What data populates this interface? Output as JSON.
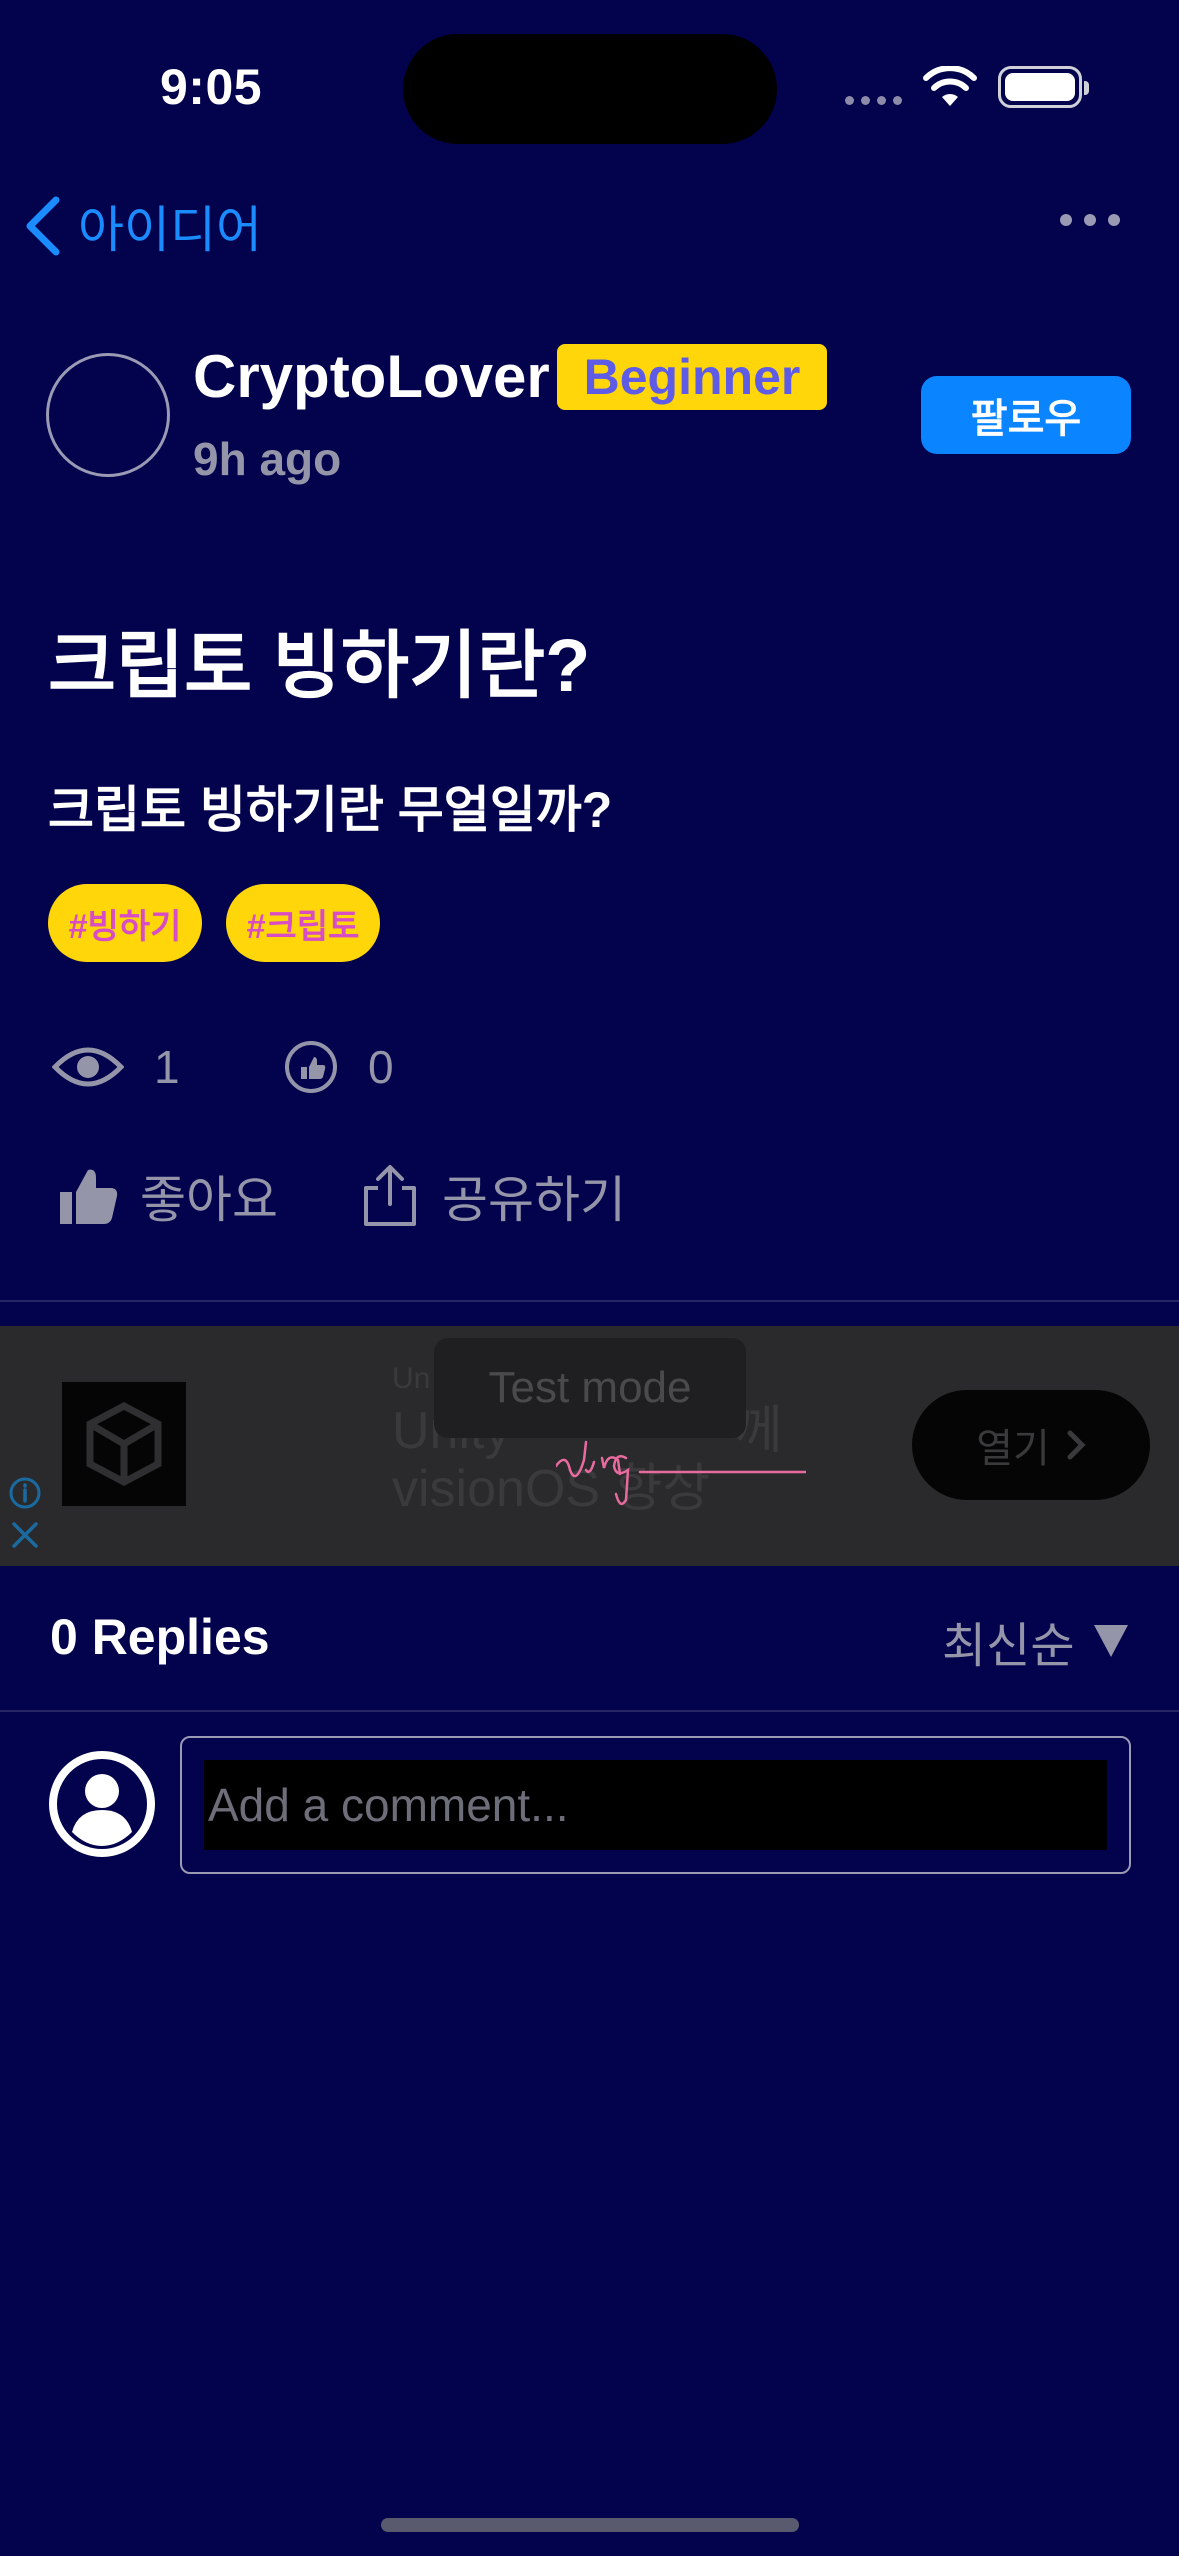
{
  "status_bar": {
    "time": "9:05"
  },
  "nav": {
    "back_label": "아이디어"
  },
  "author": {
    "name": "CryptoLover",
    "level": "Beginner",
    "time_ago": "9h ago",
    "follow_label": "팔로우"
  },
  "post": {
    "title": "크립토 빙하기란?",
    "body": "크립토 빙하기란 무얼일까?",
    "tags": [
      "#빙하기",
      "#크립토"
    ]
  },
  "stats": {
    "views": "1",
    "likes": "0"
  },
  "actions": {
    "like_label": "좋아요",
    "share_label": "공유하기"
  },
  "ad": {
    "badge": "Test mode",
    "subtitle": "Un",
    "headline_line1": "Unity ",
    "headline_line1_end": "께",
    "headline_line2": "visionOS 향상",
    "open_label": "열기"
  },
  "replies": {
    "count_label": "0 Replies",
    "sort_label": "최신순"
  },
  "comment": {
    "placeholder": "Add a comment..."
  },
  "colors": {
    "background": "#02024d",
    "accent": "#0a84ff",
    "badge": "#ffd60a",
    "badge_text": "#5e5ce6",
    "tag_text": "#d84cc6"
  }
}
